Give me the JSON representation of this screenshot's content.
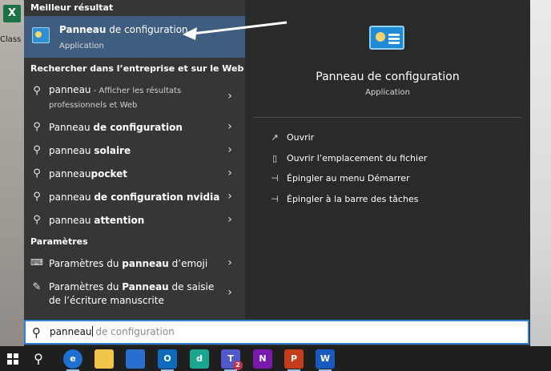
{
  "desktop": {
    "icon_letter": "X",
    "icon_label": "Class"
  },
  "sections": {
    "best_match": "Meilleur résultat",
    "web_search": "Rechercher dans l’entreprise et sur le Web",
    "settings": "Paramètres"
  },
  "best_match": {
    "title_bold": "Panneau",
    "title_rest": " de configuration",
    "subtitle": "Application"
  },
  "web_results": [
    {
      "plain": "panneau",
      "bold": "",
      "extra": " - Afficher les résultats professionnels et Web"
    },
    {
      "plain": "Panneau ",
      "bold": "de configuration",
      "extra": ""
    },
    {
      "plain": "panneau ",
      "bold": "solaire",
      "extra": ""
    },
    {
      "plain": "panneau",
      "bold": "pocket",
      "extra": ""
    },
    {
      "plain": "panneau ",
      "bold": "de configuration nvidia",
      "extra": ""
    },
    {
      "plain": "panneau ",
      "bold": "attention",
      "extra": ""
    }
  ],
  "settings_results": [
    {
      "before": "Paramètres du ",
      "bold": "panneau",
      "after": " d’emoji"
    },
    {
      "before": "Paramètres du ",
      "bold": "Panneau",
      "after": " de saisie de l’écriture manuscrite"
    }
  ],
  "detail": {
    "title": "Panneau de configuration",
    "subtitle": "Application",
    "actions": [
      {
        "icon": "open-icon",
        "label": "Ouvrir"
      },
      {
        "icon": "file-location-icon",
        "label": "Ouvrir l’emplacement du fichier"
      },
      {
        "icon": "pin-icon",
        "label": "Épingler au menu Démarrer"
      },
      {
        "icon": "pin-icon",
        "label": "Épingler à la barre des tâches"
      }
    ]
  },
  "search": {
    "typed": "panneau",
    "suggestion": " de configuration"
  },
  "taskbar": {
    "teams_badge": "2"
  },
  "colors": {
    "selection": "#3e5d7f",
    "search_border": "#2e7fd6",
    "taskbar": "#1f1f1f"
  }
}
